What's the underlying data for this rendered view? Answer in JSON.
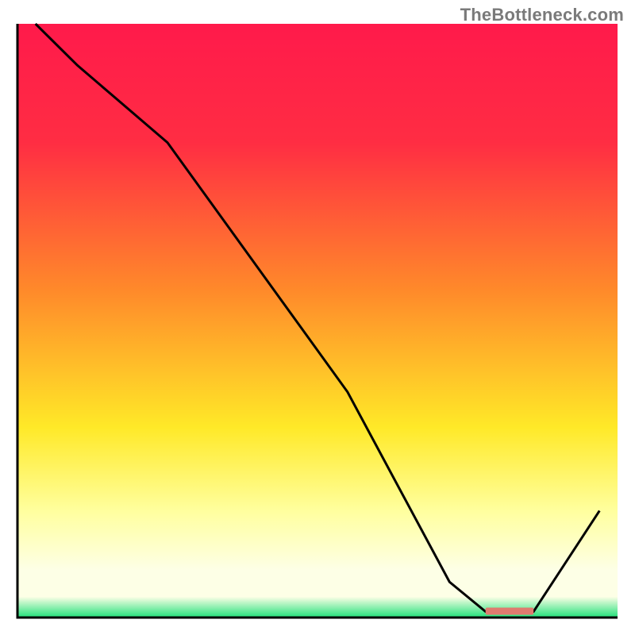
{
  "watermark": "TheBottleneck.com",
  "colors": {
    "top": "#ff1a4b",
    "red": "#ff2d43",
    "orange": "#ff8a2a",
    "yellow": "#ffe928",
    "pale_yellow": "#ffff9e",
    "near_white": "#fdffe6",
    "green": "#20e07a",
    "line": "#000000",
    "marker": "#e07a6f",
    "border": "#000000"
  },
  "chart_data": {
    "type": "line",
    "title": "",
    "xlabel": "",
    "ylabel": "",
    "xlim": [
      0,
      100
    ],
    "ylim": [
      0,
      100
    ],
    "x": [
      3,
      10,
      25,
      55,
      72,
      78,
      86,
      97
    ],
    "values": [
      100,
      93,
      80,
      38,
      6,
      1,
      1,
      18
    ],
    "annotations": [
      {
        "name": "optimal-marker",
        "x_start": 78,
        "x_end": 86,
        "y": 1
      }
    ]
  }
}
